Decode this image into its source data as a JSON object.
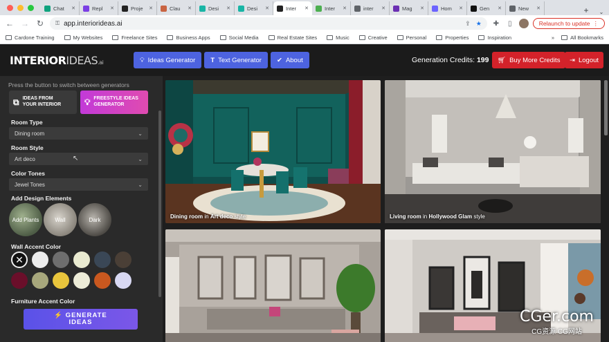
{
  "browser": {
    "tabs": [
      {
        "label": "Chat",
        "color": "#10a37f"
      },
      {
        "label": "Repl",
        "color": "#7b3fe4"
      },
      {
        "label": "Proje",
        "color": "#222222"
      },
      {
        "label": "Clau",
        "color": "#c96442"
      },
      {
        "label": "Desi",
        "color": "#19b5a5"
      },
      {
        "label": "Desi",
        "color": "#19b5a5"
      },
      {
        "label": "Inter",
        "color": "#222222",
        "active": true
      },
      {
        "label": "Inter",
        "color": "#4caf50"
      },
      {
        "label": "inter",
        "color": "#5f6368"
      },
      {
        "label": "Mag",
        "color": "#6b2fb3"
      },
      {
        "label": "Hom",
        "color": "#6c63ff"
      },
      {
        "label": "Gen",
        "color": "#111111"
      },
      {
        "label": "New",
        "color": "#5f6368"
      }
    ],
    "url": "app.interiorideas.ai",
    "relaunch_label": "Relaunch to update",
    "bookmarks": [
      "Cardone Training",
      "My Websites",
      "Freelance Sites",
      "Business Apps",
      "Social Media",
      "Real Estate Sites",
      "Music",
      "Creative",
      "Personal",
      "Properties",
      "Inspiration"
    ],
    "all_bookmarks_label": "All Bookmarks"
  },
  "header": {
    "logo_bold": "INTERIOR",
    "logo_light": "IDEAS",
    "logo_suffix": ".ai",
    "nav": [
      {
        "label": "Ideas Generator",
        "icon": "lightbulb-icon"
      },
      {
        "label": "Text Generator",
        "icon": "text-icon"
      },
      {
        "label": "About",
        "icon": "check-circle-icon"
      }
    ],
    "credits_label": "Generation Credits:",
    "credits_value": "199",
    "buy_label": "Buy More Credits",
    "logout_label": "Logout"
  },
  "sidebar": {
    "hint": "Press the button to switch between generators",
    "mode_interior_line1": "IDEAS FROM",
    "mode_interior_line2": "YOUR INTERIOR",
    "mode_freestyle_line1": "FREESTYLE IDEAS",
    "mode_freestyle_line2": "GENERATOR",
    "room_type_label": "Room Type",
    "room_type_value": "Dining room",
    "room_style_label": "Room Style",
    "room_style_value": "Art deco",
    "color_tones_label": "Color Tones",
    "color_tones_value": "Jewel Tones",
    "design_elements_label": "Add Design Elements",
    "design_elements": [
      "Add Plants",
      "Wall",
      "Dark"
    ],
    "wall_accent_label": "Wall Accent Color",
    "wall_colors": [
      "none",
      "#ececec",
      "#6e6e6e",
      "#e9ead0",
      "#3a4756",
      "#4a3f36",
      "#6a0f2a",
      "#a7a77c",
      "#e9c53c",
      "#ecebd7",
      "#c9581f",
      "#d8d8f2"
    ],
    "furniture_accent_label": "Furniture Accent Color",
    "generate_line1": "⚡ GENERATE",
    "generate_line2": "IDEAS"
  },
  "gallery": [
    {
      "room": "Dining room",
      "style": "Art deco"
    },
    {
      "room": "Living room",
      "style": "Hollywood Glam"
    },
    {
      "room": "",
      "style": ""
    },
    {
      "room": "",
      "style": ""
    }
  ],
  "caption_in": "in",
  "caption_style": "style",
  "watermark": {
    "line1": "CGer.com",
    "line2": "CG资源 CG网站"
  }
}
